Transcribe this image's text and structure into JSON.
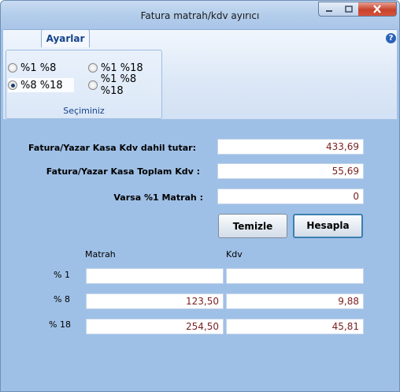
{
  "window": {
    "title": "Fatura matrah/kdv ayırıcı"
  },
  "ribbon": {
    "tab": "Ayarlar",
    "group_label": "Seçiminiz",
    "options": [
      {
        "label": "%1 %8",
        "checked": false
      },
      {
        "label": "%1 %18",
        "checked": false
      },
      {
        "label": "%8 %18",
        "checked": true
      },
      {
        "label": "%1 %8 %18",
        "checked": false
      }
    ]
  },
  "form": {
    "total_label": "Fatura/Yazar  Kasa  Kdv dahil tutar:",
    "total_value": "433,69",
    "kdv_label": "Fatura/Yazar Kasa Toplam Kdv :",
    "kdv_value": "55,69",
    "matrah1_label": "Varsa %1 Matrah :",
    "matrah1_value": "0"
  },
  "buttons": {
    "clear": "Temizle",
    "calculate": "Hesapla"
  },
  "results": {
    "col_matrah": "Matrah",
    "col_kdv": "Kdv",
    "rows": [
      {
        "label": "%  1",
        "matrah": "",
        "kdv": ""
      },
      {
        "label": "%  8",
        "matrah": "123,50",
        "kdv": "9,88"
      },
      {
        "label": "% 18",
        "matrah": "254,50",
        "kdv": "45,81"
      }
    ]
  }
}
